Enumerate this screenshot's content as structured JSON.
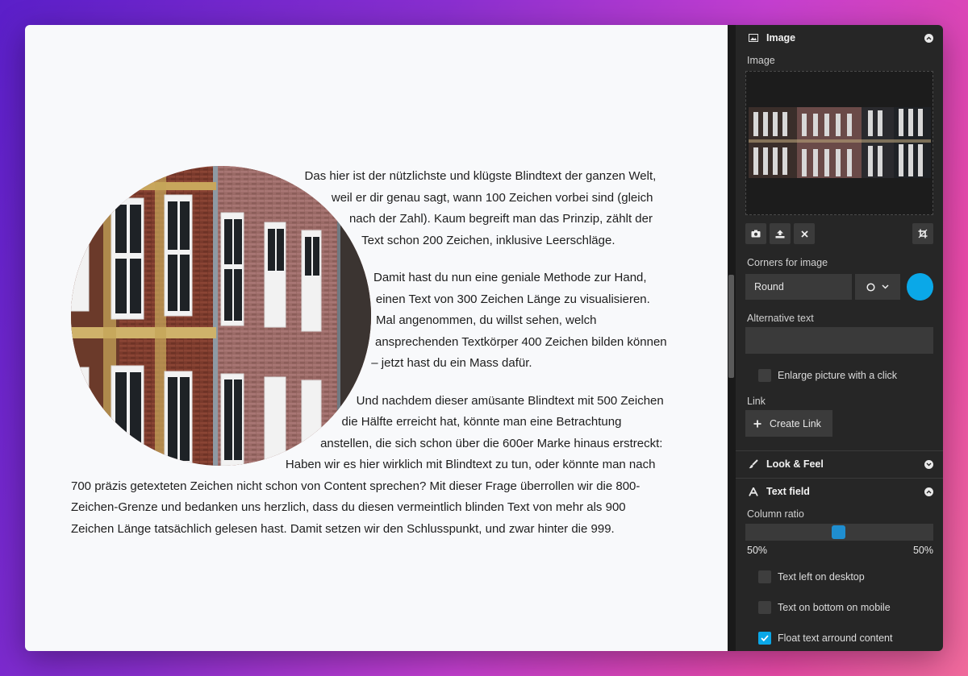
{
  "article": {
    "paragraphs": [
      "Das hier ist der nützlichste und klügste Blindtext der ganzen Welt, weil er dir genau sagt, wann 100 Zeichen vorbei sind (gleich nach der Zahl). Kaum begreift man das Prinzip, zählt der Text schon 200 Zeichen, inklusive Leerschläge.",
      "Damit hast du nun eine geniale Methode zur Hand, einen Text von 300 Zeichen Länge zu visualisieren. Mal angenommen, du willst sehen, welch ansprechenden Textkörper 400 Zeichen bilden können – jetzt hast du ein Mass dafür.",
      "Und nachdem dieser amüsante Blindtext mit 500 Zeichen die Hälfte erreicht hat, könnte man eine Betrachtung anstellen, die sich schon über die 600er Marke hinaus erstreckt: Haben wir es hier wirklich mit Blindtext zu tun, oder könnte man nach 700 präzis getexteten Zeichen nicht schon von Content sprechen? Mit dieser Frage überrollen wir die 800-Zeichen-Grenze und bedanken uns herzlich, dass du diesen vermeintlich blinden Text von mehr als 900 Zeichen Länge tatsächlich gelesen hast. Damit setzen wir den Schlusspunkt, und zwar hinter die 999."
    ]
  },
  "panel": {
    "image_section": {
      "title": "Image",
      "icon": "image-icon",
      "image_label": "Image",
      "tools": [
        "camera-icon",
        "upload-icon",
        "close-icon"
      ],
      "crop_tool": "crop-icon",
      "corners_label": "Corners for image",
      "corners_value": "Round",
      "corner_style": "circle-outline-icon",
      "color": "#0aa8e8",
      "alt_label": "Alternative text",
      "alt_value": "",
      "enlarge_label": "Enlarge picture with a click",
      "enlarge_checked": false,
      "link_label": "Link",
      "create_link": "Create Link"
    },
    "look_section": {
      "title": "Look & Feel",
      "icon": "brush-icon"
    },
    "text_section": {
      "title": "Text field",
      "icon": "text-icon",
      "ratio_label": "Column ratio",
      "ratio_left": "50%",
      "ratio_right": "50%",
      "ratio_value": 0.5,
      "options": [
        {
          "label": "Text left on desktop",
          "checked": false
        },
        {
          "label": "Text on bottom on mobile",
          "checked": false
        },
        {
          "label": "Float text arround content",
          "checked": true
        }
      ]
    }
  },
  "colors": {
    "accent": "#0aa8e8",
    "panel_bg": "#262626",
    "canvas_bg": "#f8f9fb"
  }
}
